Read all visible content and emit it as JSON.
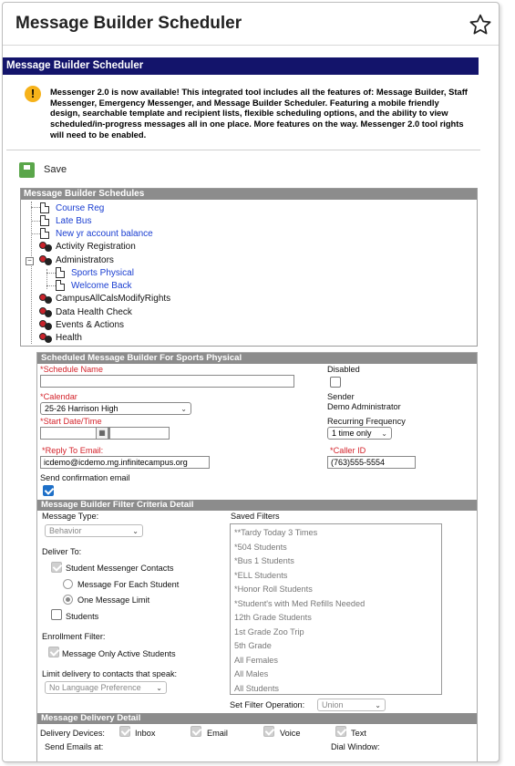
{
  "page": {
    "title": "Message Builder Scheduler",
    "tool_header": "Message Builder Scheduler"
  },
  "notice": {
    "text": "Messenger 2.0 is now available! This integrated tool includes all the features of: Message Builder, Staff Messenger, Emergency Messenger, and Message Builder Scheduler. Featuring a mobile friendly design, searchable template and recipient lists, flexible scheduling options, and the ability to view scheduled/in-progress messages all in one place. More features on the way. Messenger 2.0 tool rights will need to be enabled."
  },
  "toolbar": {
    "save_label": "Save"
  },
  "tree": {
    "header": "Message Builder Schedules",
    "items": [
      {
        "label": "Course Reg",
        "type": "doc"
      },
      {
        "label": "Late Bus",
        "type": "doc"
      },
      {
        "label": "New yr account balance",
        "type": "doc"
      },
      {
        "label": "Activity Registration",
        "type": "group"
      },
      {
        "label": "Administrators",
        "type": "group"
      },
      {
        "label": "Sports Physical",
        "type": "doc"
      },
      {
        "label": "Welcome Back",
        "type": "doc"
      },
      {
        "label": "CampusAllCalsModifyRights",
        "type": "group"
      },
      {
        "label": "Data Health Check",
        "type": "group"
      },
      {
        "label": "Events & Actions",
        "type": "group"
      },
      {
        "label": "Health",
        "type": "group"
      }
    ]
  },
  "schedule": {
    "header": "Scheduled Message Builder For Sports Physical",
    "schedule_name_label": "*Schedule Name",
    "schedule_name_value": "",
    "disabled_label": "Disabled",
    "calendar_label": "*Calendar",
    "calendar_value": "25-26 Harrison High",
    "sender_label": "Sender",
    "sender_value": "Demo Administrator",
    "start_label": "*Start Date/Time",
    "start_date": "",
    "start_time": "",
    "recurring_label": "Recurring Frequency",
    "recurring_value": "1 time only",
    "reply_label": "*Reply To Email:",
    "reply_value": "icdemo@icdemo.mg.infinitecampus.org",
    "caller_label": "*Caller ID",
    "caller_value": "(763)555-5554",
    "confirm_label": "Send confirmation email"
  },
  "filter": {
    "header": "Message Builder Filter Criteria Detail",
    "message_type_label": "Message Type:",
    "message_type_value": "Behavior",
    "deliver_to_label": "Deliver To:",
    "student_contacts_label": "Student Messenger Contacts",
    "each_student_label": "Message For Each Student",
    "one_message_label": "One Message Limit",
    "students_label": "Students",
    "enrollment_label": "Enrollment Filter:",
    "active_students_label": "Message Only Active Students",
    "language_label": "Limit delivery to contacts that speak:",
    "language_value": "No Language Preference",
    "saved_filters_label": "Saved Filters",
    "saved_filters": [
      "**Tardy Today 3 Times",
      "*504 Students",
      "*Bus 1 Students",
      "*ELL Students",
      "*Honor Roll Students",
      "*Student's with Med Refills Needed",
      "12th Grade Students",
      "1st Grade Zoo Trip",
      "5th Grade",
      "All Females",
      "All Males",
      "All Students"
    ],
    "set_operation_label": "Set Filter Operation:",
    "set_operation_value": "Union"
  },
  "delivery": {
    "header": "Message Delivery Detail",
    "devices_label": "Delivery Devices:",
    "inbox_label": "Inbox",
    "email_label": "Email",
    "voice_label": "Voice",
    "text_label": "Text",
    "send_emails_label": "Send Emails at:",
    "dial_window_label": "Dial Window:"
  },
  "colors": {
    "header_bg": "#13146b",
    "section_bg": "#8c8c8c",
    "required": "#d4232b",
    "link": "#1a3ed1",
    "warning": "#f6b21a",
    "save_green": "#5aa64a",
    "checkbox_blue": "#1e70c8"
  }
}
